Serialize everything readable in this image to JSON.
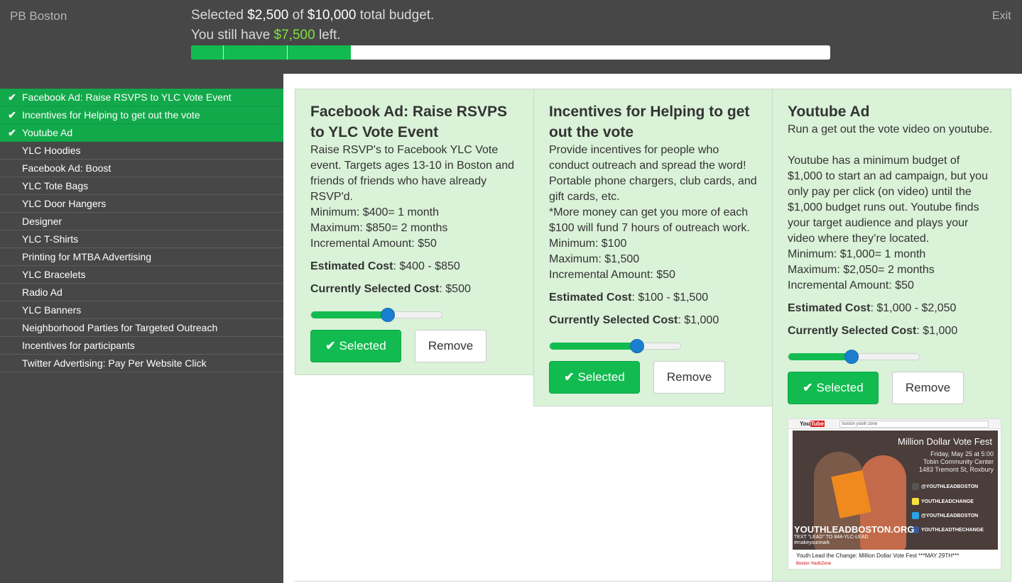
{
  "header": {
    "brand": "PB Boston",
    "line1": {
      "pre": "Selected ",
      "selected": "$2,500",
      "mid": " of ",
      "total": "$10,000",
      "post": " total budget."
    },
    "line2": {
      "pre": "You still have ",
      "left": "$7,500",
      "post": " left."
    },
    "exit": "Exit",
    "progress_segments_fraction": [
      0.05,
      0.1,
      0.1
    ]
  },
  "sidebar": {
    "items": [
      {
        "label": "Facebook Ad: Raise RSVPS to YLC Vote Event",
        "selected": true
      },
      {
        "label": "Incentives for Helping to get out the vote",
        "selected": true
      },
      {
        "label": "Youtube Ad",
        "selected": true
      },
      {
        "label": "YLC Hoodies",
        "selected": false
      },
      {
        "label": "Facebook Ad: Boost",
        "selected": false
      },
      {
        "label": "YLC Tote Bags",
        "selected": false
      },
      {
        "label": "YLC Door Hangers",
        "selected": false
      },
      {
        "label": "Designer",
        "selected": false
      },
      {
        "label": "YLC T-Shirts",
        "selected": false
      },
      {
        "label": "Printing for MTBA Advertising",
        "selected": false
      },
      {
        "label": "YLC Bracelets",
        "selected": false
      },
      {
        "label": "Radio Ad",
        "selected": false
      },
      {
        "label": "YLC Banners",
        "selected": false
      },
      {
        "label": "Neighborhood Parties for Targeted Outreach",
        "selected": false
      },
      {
        "label": "Incentives for participants",
        "selected": false
      },
      {
        "label": "Twitter Advertising: Pay Per Website Click",
        "selected": false
      }
    ],
    "check_glyph": "✔"
  },
  "labels": {
    "estimated": "Estimated Cost",
    "current": "Currently Selected Cost",
    "selected_btn": "Selected",
    "remove_btn": "Remove"
  },
  "cards": [
    {
      "title": "Facebook Ad: Raise RSVPS to YLC Vote Event",
      "description": "Raise RSVP's to Facebook YLC Vote event. Targets ages 13-10 in Boston and friends of friends who have already RSVP'd.\nMinimum: $400= 1 month\nMaximum: $850= 2 months\nIncremental Amount: $50",
      "estimated": "$400 - $850",
      "current": "$500",
      "slider_fraction": 0.58
    },
    {
      "title": "Incentives for Helping to get out the vote",
      "description": "Provide incentives for people who conduct outreach and spread the word! Portable phone chargers, club cards, and gift cards, etc.\n*More money can get you more of each $100 will fund 7 hours of outreach work.\nMinimum: $100\nMaximum: $1,500\nIncremental Amount: $50",
      "estimated": "$100 - $1,500",
      "current": "$1,000",
      "slider_fraction": 0.66
    },
    {
      "title": "Youtube Ad",
      "description": "Run a get out the vote video on youtube.\n\nYoutube has a minimum budget of $1,000 to start an ad campaign, but you only pay per click (on video) until the $1,000 budget runs out. Youtube finds your target audience and plays your video where they’re located.\nMinimum: $1,000= 1 month\nMaximum: $2,050= 2 months\nIncremental Amount: $50",
      "estimated": "$1,000 - $2,050",
      "current": "$1,000",
      "slider_fraction": 0.48
    }
  ],
  "thumbnail": {
    "logo": "You",
    "logo_tube": "Tube",
    "search": "boston youth zone",
    "title": "Million Dollar Vote Fest",
    "subtitle": "Friday, May 25 at 5:00\nTobin Community Center\n1483 Tremont St, Roxbury",
    "handles": [
      "@YOUTHLEADBOSTON",
      "YOUTHLEADCHANGE",
      "@YOUTHLEADBOSTON",
      "YOUTHLEADTHECHANGE"
    ],
    "handle_colors": [
      "#555555",
      "#f6e23a",
      "#2aa3e6",
      "#3b5998"
    ],
    "site": "YOUTHLEADBOSTON.ORG",
    "text": "TEXT \"LEAD\" TO 844-YLC-LEAD\n#makeyourmark",
    "caption": "Youth Lead the Change: Million Dollar Vote Fest ***MAY 29TH***",
    "channel": "Boston YouthZone"
  }
}
